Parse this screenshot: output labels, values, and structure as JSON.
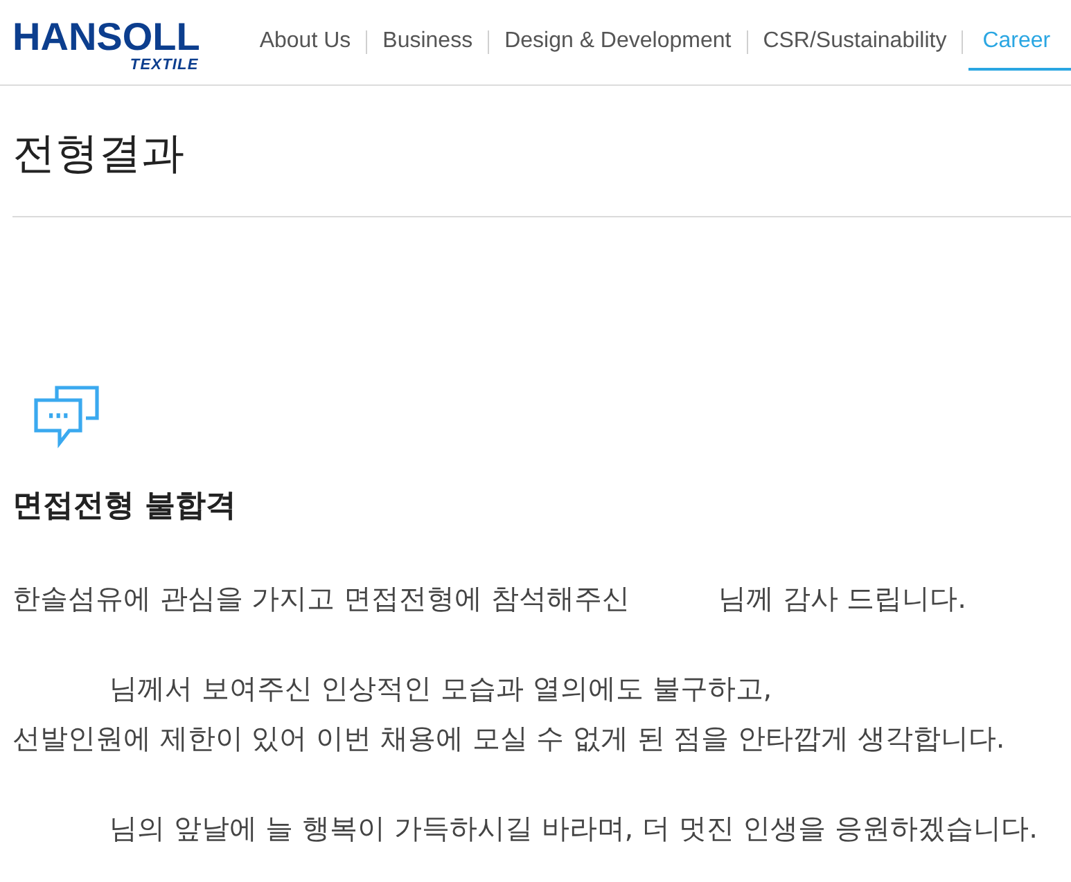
{
  "header": {
    "logo": {
      "wordmark": "HANSOLL",
      "tagline": "TEXTILE"
    },
    "nav": [
      {
        "label": "About Us",
        "selected": false
      },
      {
        "label": "Business",
        "selected": false
      },
      {
        "label": "Design & Development",
        "selected": false
      },
      {
        "label": "CSR/Sustainability",
        "selected": false
      },
      {
        "label": "Career",
        "selected": true
      }
    ]
  },
  "page_title": "전형결과",
  "result": {
    "heading": "면접전형 불합격",
    "paragraphs": [
      {
        "before_blank": "한솔섬유에 관심을 가지고 면접전형에 참석해주신",
        "after_blank": [
          "님께 감사 드립니다."
        ]
      },
      {
        "after_blank": [
          "님께서 보여주신 인상적인 모습과 열의에도 불구하고,",
          "선발인원에 제한이 있어 이번 채용에 모실 수 없게 된 점을 안타깝게 생각합니다."
        ]
      },
      {
        "after_blank": [
          "님의 앞날에 늘 행복이 가득하시길 바라며, 더 멋진 인생을 응원하겠습니다."
        ]
      }
    ]
  }
}
